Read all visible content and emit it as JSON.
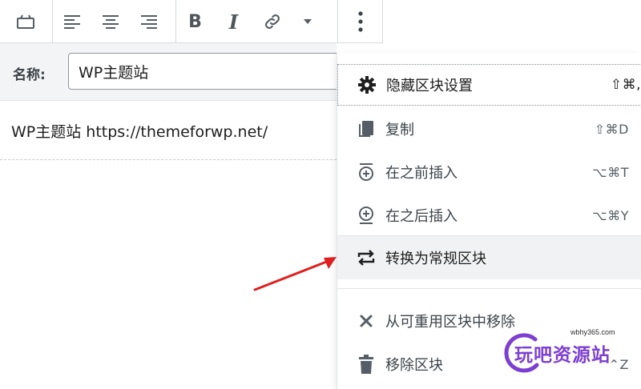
{
  "toolbar": {
    "block_icon": "reusable-block-icon",
    "align_left_icon": "align-left-icon",
    "align_center_icon": "align-center-icon",
    "align_right_icon": "align-right-icon",
    "bold_label": "B",
    "italic_label": "I",
    "link_icon": "link-icon",
    "more_formats_icon": "caret-down-icon",
    "more_options_icon": "vertical-ellipsis-icon"
  },
  "name_field": {
    "label": "名称:",
    "value": "WP主题站"
  },
  "content": {
    "text": "WP主题站 https://themeforwp.net/"
  },
  "menu": {
    "items": [
      {
        "label": "隐藏区块设置",
        "shortcut": "⇧⌘,",
        "icon": "gear-icon"
      },
      {
        "label": "复制",
        "shortcut": "⇧⌘D",
        "icon": "duplicate-icon"
      },
      {
        "label": "在之前插入",
        "shortcut": "⌥⌘T",
        "icon": "insert-before-icon"
      },
      {
        "label": "在之后插入",
        "shortcut": "⌥⌘Y",
        "icon": "insert-after-icon"
      },
      {
        "label": "转换为常规区块",
        "shortcut": "",
        "icon": "convert-icon"
      },
      {
        "label": "从可重用区块中移除",
        "shortcut": "",
        "icon": "close-icon"
      },
      {
        "label": "移除区块",
        "shortcut": "⌃Z",
        "icon": "trash-icon"
      }
    ]
  },
  "watermark": {
    "domain": "wbhy365.com",
    "name": "玩吧资源站"
  },
  "colors": {
    "arrow": "#e02020",
    "watermark": "#7c3fd1",
    "highlight_bg": "#f1f2f3"
  }
}
